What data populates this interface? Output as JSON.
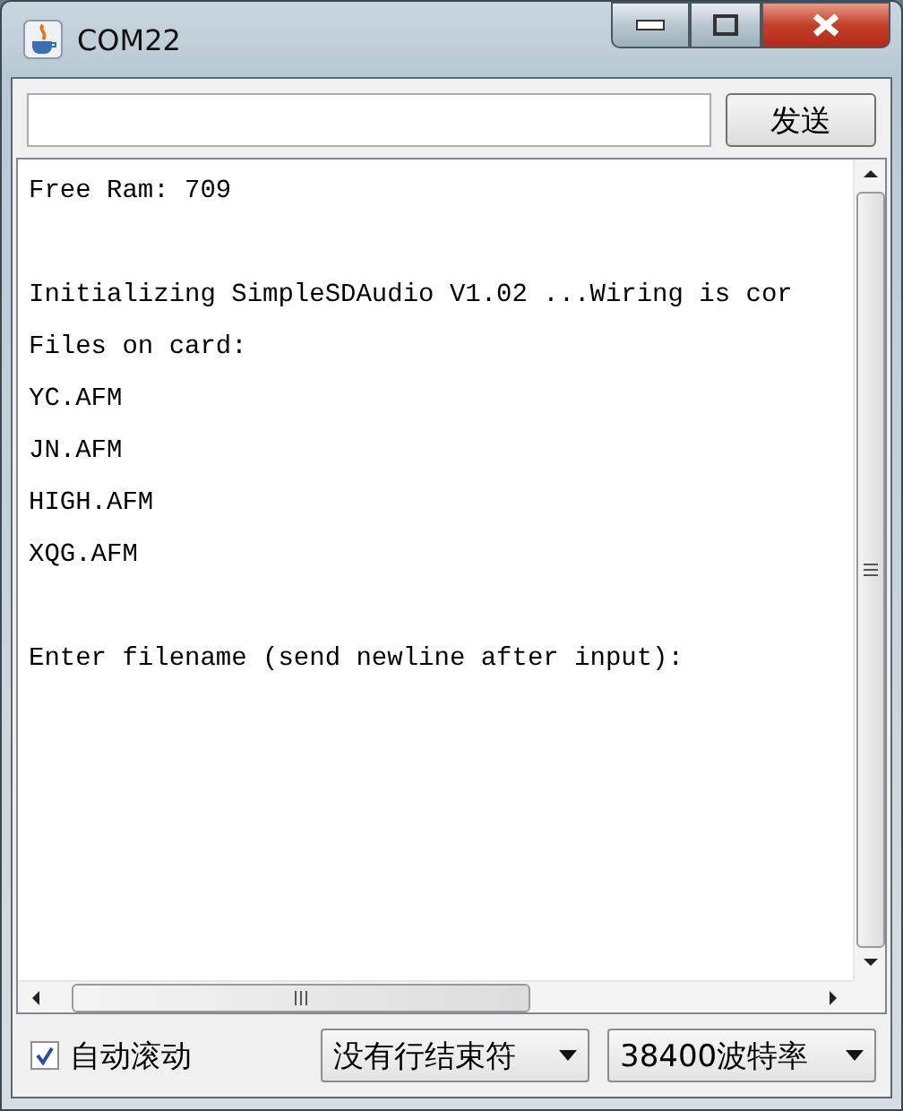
{
  "window": {
    "title": "COM22"
  },
  "send": {
    "button": "发送"
  },
  "output": {
    "paragraphs": [
      [
        "Free Ram: 709"
      ],
      [
        "Initializing SimpleSDAudio V1.02 ...Wiring is cor",
        "Files on card:",
        "YC.AFM",
        "JN.AFM",
        "HIGH.AFM",
        "XQG.AFM"
      ],
      [
        "Enter filename (send newline after input):"
      ]
    ]
  },
  "footer": {
    "autoscroll": {
      "label": "自动滚动",
      "checked": true
    },
    "line_ending": "没有行结束符",
    "baud_rate": "38400波特率"
  }
}
